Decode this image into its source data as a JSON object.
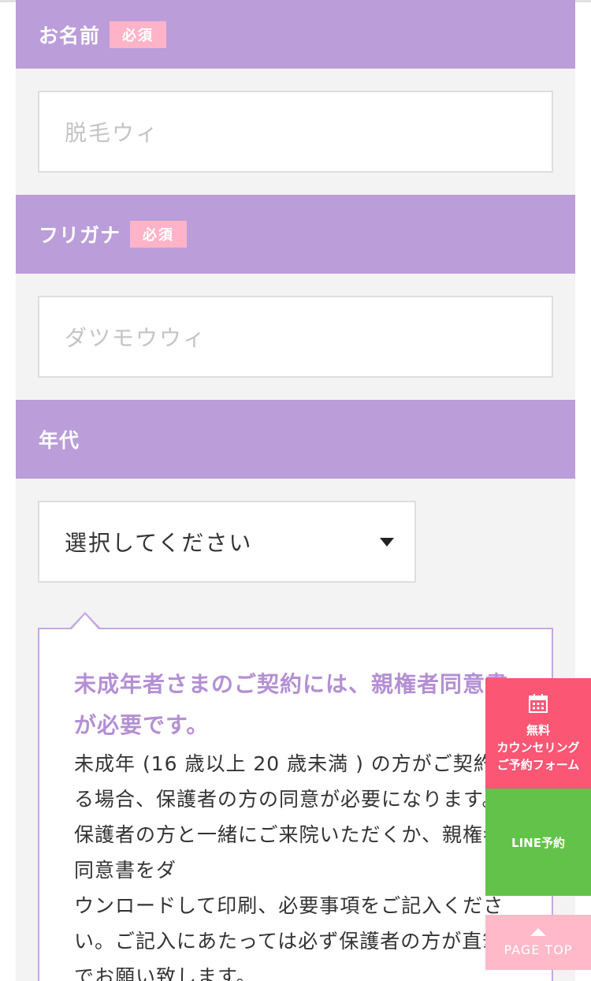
{
  "form": {
    "name": {
      "label": "お名前",
      "badge": "必須",
      "placeholder": "脱毛ウィ"
    },
    "furigana": {
      "label": "フリガナ",
      "badge": "必須",
      "placeholder": "ダツモウウィ"
    },
    "age": {
      "label": "年代",
      "selected": "選択してください"
    }
  },
  "notice": {
    "title": "未成年者さまのご契約には、親権者同意書が必要です。",
    "body": [
      "未成年 (16 歳以上 20 歳未満 ) の方がご契約する場合、保護者の方の同意が必要になります。保護者の方と一緒にご来院いただくか、親権者同意書をダ",
      "ウンロードして印刷、必要事項をご記入ください。ご記入にあたっては必ず保護者の方が直筆でお願い致します。"
    ]
  },
  "floating": {
    "counsel": {
      "line1": "無料",
      "line2": "カウンセリング",
      "line3": "ご予約フォーム"
    },
    "line": {
      "label": "LINE予約"
    },
    "page_top": {
      "label": "PAGE TOP"
    }
  },
  "colors": {
    "section_header": "#ba9dd9",
    "required_badge": "#ffb3c8",
    "notice_title": "#b48fd4",
    "counsel_button": "#fb5674",
    "line_button": "#63c24a",
    "page_top_button": "#ffb9c9"
  },
  "icons": {
    "counsel": "calendar-icon",
    "select": "caret-down-icon",
    "page_top": "arrow-up-icon"
  }
}
